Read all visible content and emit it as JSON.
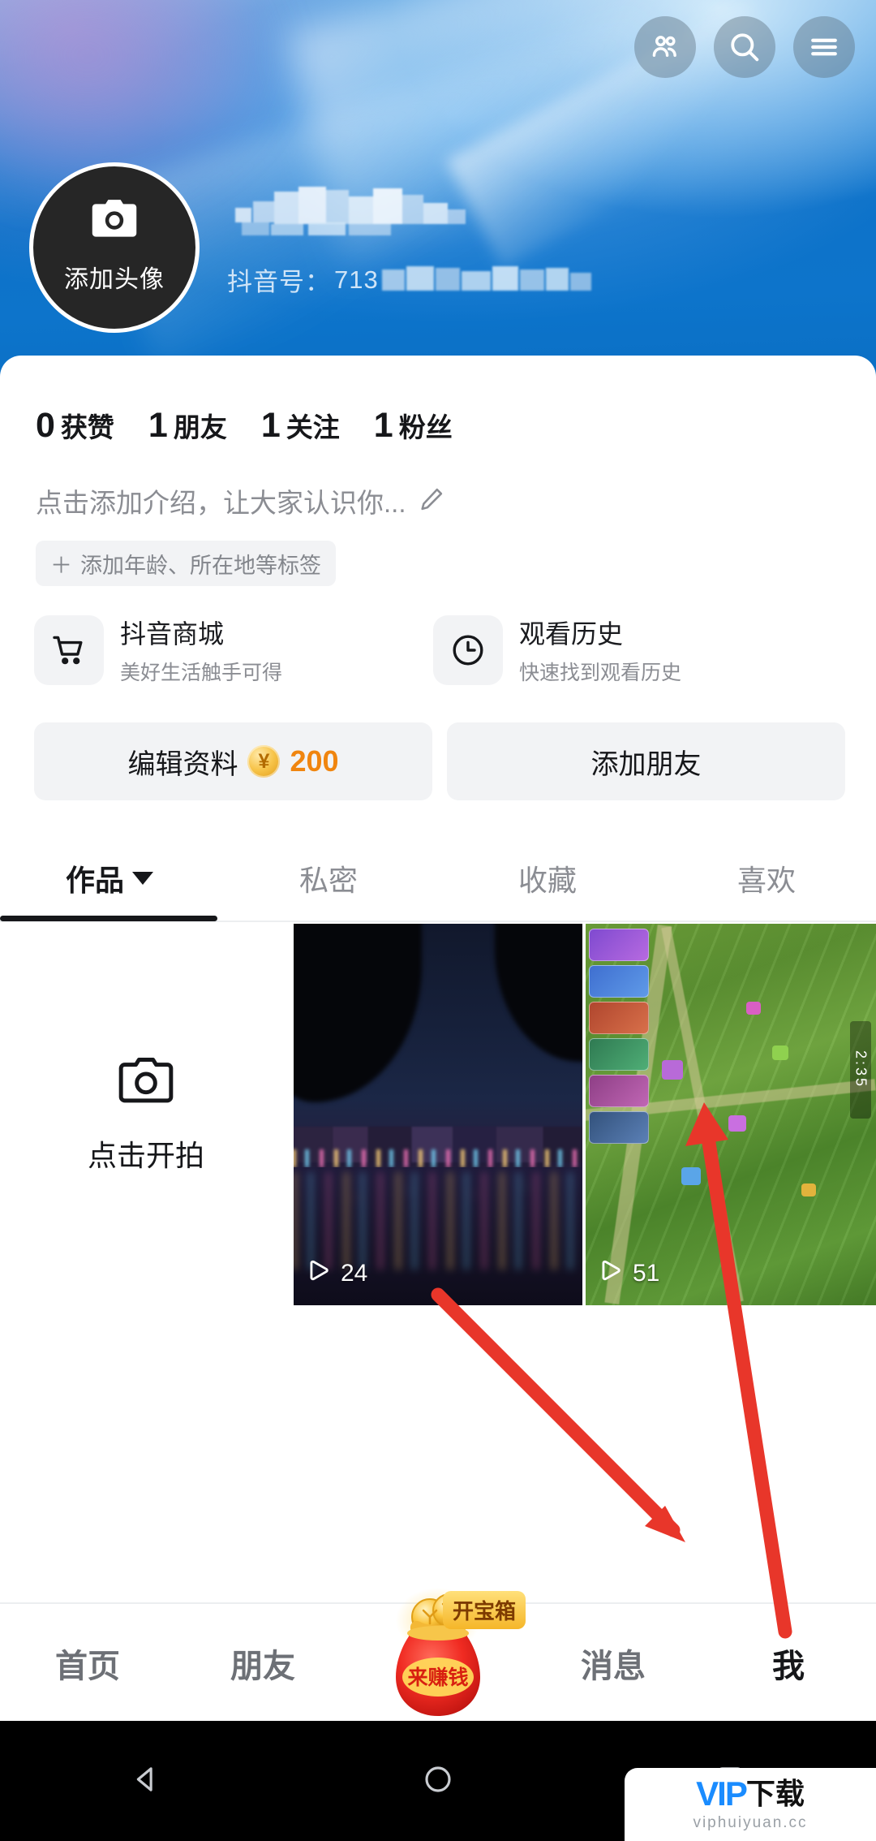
{
  "header": {
    "icons": [
      {
        "name": "friends-icon",
        "label": "朋友"
      },
      {
        "name": "search-icon",
        "label": "搜索"
      },
      {
        "name": "menu-icon",
        "label": "菜单"
      }
    ],
    "avatar": {
      "add_label": "添加头像",
      "icon": "camera-icon"
    },
    "nickname": "",
    "douyin_id_label": "抖音号：",
    "douyin_id_value": "713"
  },
  "stats": [
    {
      "num": "0",
      "label": "获赞"
    },
    {
      "num": "1",
      "label": "朋友"
    },
    {
      "num": "1",
      "label": "关注"
    },
    {
      "num": "1",
      "label": "粉丝"
    }
  ],
  "bio": {
    "placeholder": "点击添加介绍，让大家认识你...",
    "edit_icon": "pencil-icon"
  },
  "tag_chip": {
    "plus": "＋",
    "label": "添加年龄、所在地等标签"
  },
  "cards": [
    {
      "icon": "cart-icon",
      "title": "抖音商城",
      "subtitle": "美好生活触手可得"
    },
    {
      "icon": "clock-icon",
      "title": "观看历史",
      "subtitle": "快速找到观看历史"
    }
  ],
  "buttons": {
    "edit_profile": "编辑资料",
    "coin_symbol": "¥",
    "coin_value": "200",
    "add_friend": "添加朋友"
  },
  "tabs": [
    {
      "label": "作品",
      "active": true,
      "has_caret": true
    },
    {
      "label": "私密",
      "active": false,
      "has_caret": false
    },
    {
      "label": "收藏",
      "active": false,
      "has_caret": false
    },
    {
      "label": "喜欢",
      "active": false,
      "has_caret": false
    }
  ],
  "grid": {
    "shoot": {
      "icon": "camera-icon",
      "label": "点击开拍"
    },
    "items": [
      {
        "name": "night-city-video",
        "plays": "24",
        "play_icon": "play-icon"
      },
      {
        "name": "game-video",
        "plays": "51",
        "play_icon": "play-icon"
      }
    ]
  },
  "bottom_nav": [
    {
      "label": "首页",
      "active": false
    },
    {
      "label": "朋友",
      "active": false
    },
    {
      "label": "来赚钱",
      "badge": "开宝箱",
      "active": false,
      "is_money_bag": true
    },
    {
      "label": "消息",
      "active": false
    },
    {
      "label": "我",
      "active": true
    }
  ],
  "android_bar": {
    "back": "back-triangle-icon",
    "home": "home-circle-icon",
    "recents": "recents-square-icon"
  },
  "watermark": {
    "v": "V",
    "ip": "IP",
    "cn": "下载",
    "url": "viphuiyuan.cc"
  },
  "colors": {
    "header_blue": "#0d72c9",
    "accent_orange": "#f0850f",
    "text_dark": "#16171a",
    "text_muted": "#8b8d93",
    "chip_bg": "#f2f3f5",
    "annotation_red": "#e8362a"
  }
}
